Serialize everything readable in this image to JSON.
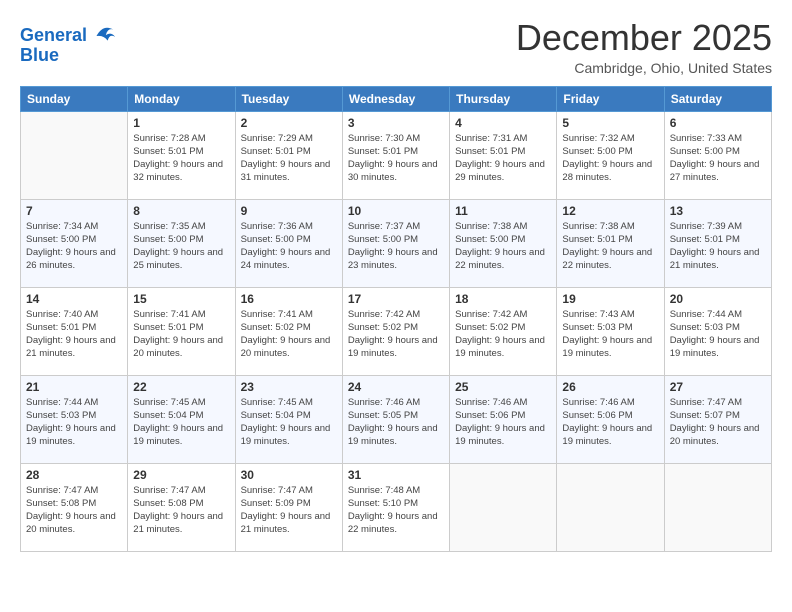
{
  "header": {
    "logo_line1": "General",
    "logo_line2": "Blue",
    "month": "December 2025",
    "location": "Cambridge, Ohio, United States"
  },
  "weekdays": [
    "Sunday",
    "Monday",
    "Tuesday",
    "Wednesday",
    "Thursday",
    "Friday",
    "Saturday"
  ],
  "weeks": [
    [
      {
        "num": "",
        "sunrise": "",
        "sunset": "",
        "daylight": ""
      },
      {
        "num": "1",
        "sunrise": "Sunrise: 7:28 AM",
        "sunset": "Sunset: 5:01 PM",
        "daylight": "Daylight: 9 hours and 32 minutes."
      },
      {
        "num": "2",
        "sunrise": "Sunrise: 7:29 AM",
        "sunset": "Sunset: 5:01 PM",
        "daylight": "Daylight: 9 hours and 31 minutes."
      },
      {
        "num": "3",
        "sunrise": "Sunrise: 7:30 AM",
        "sunset": "Sunset: 5:01 PM",
        "daylight": "Daylight: 9 hours and 30 minutes."
      },
      {
        "num": "4",
        "sunrise": "Sunrise: 7:31 AM",
        "sunset": "Sunset: 5:01 PM",
        "daylight": "Daylight: 9 hours and 29 minutes."
      },
      {
        "num": "5",
        "sunrise": "Sunrise: 7:32 AM",
        "sunset": "Sunset: 5:00 PM",
        "daylight": "Daylight: 9 hours and 28 minutes."
      },
      {
        "num": "6",
        "sunrise": "Sunrise: 7:33 AM",
        "sunset": "Sunset: 5:00 PM",
        "daylight": "Daylight: 9 hours and 27 minutes."
      }
    ],
    [
      {
        "num": "7",
        "sunrise": "Sunrise: 7:34 AM",
        "sunset": "Sunset: 5:00 PM",
        "daylight": "Daylight: 9 hours and 26 minutes."
      },
      {
        "num": "8",
        "sunrise": "Sunrise: 7:35 AM",
        "sunset": "Sunset: 5:00 PM",
        "daylight": "Daylight: 9 hours and 25 minutes."
      },
      {
        "num": "9",
        "sunrise": "Sunrise: 7:36 AM",
        "sunset": "Sunset: 5:00 PM",
        "daylight": "Daylight: 9 hours and 24 minutes."
      },
      {
        "num": "10",
        "sunrise": "Sunrise: 7:37 AM",
        "sunset": "Sunset: 5:00 PM",
        "daylight": "Daylight: 9 hours and 23 minutes."
      },
      {
        "num": "11",
        "sunrise": "Sunrise: 7:38 AM",
        "sunset": "Sunset: 5:00 PM",
        "daylight": "Daylight: 9 hours and 22 minutes."
      },
      {
        "num": "12",
        "sunrise": "Sunrise: 7:38 AM",
        "sunset": "Sunset: 5:01 PM",
        "daylight": "Daylight: 9 hours and 22 minutes."
      },
      {
        "num": "13",
        "sunrise": "Sunrise: 7:39 AM",
        "sunset": "Sunset: 5:01 PM",
        "daylight": "Daylight: 9 hours and 21 minutes."
      }
    ],
    [
      {
        "num": "14",
        "sunrise": "Sunrise: 7:40 AM",
        "sunset": "Sunset: 5:01 PM",
        "daylight": "Daylight: 9 hours and 21 minutes."
      },
      {
        "num": "15",
        "sunrise": "Sunrise: 7:41 AM",
        "sunset": "Sunset: 5:01 PM",
        "daylight": "Daylight: 9 hours and 20 minutes."
      },
      {
        "num": "16",
        "sunrise": "Sunrise: 7:41 AM",
        "sunset": "Sunset: 5:02 PM",
        "daylight": "Daylight: 9 hours and 20 minutes."
      },
      {
        "num": "17",
        "sunrise": "Sunrise: 7:42 AM",
        "sunset": "Sunset: 5:02 PM",
        "daylight": "Daylight: 9 hours and 19 minutes."
      },
      {
        "num": "18",
        "sunrise": "Sunrise: 7:42 AM",
        "sunset": "Sunset: 5:02 PM",
        "daylight": "Daylight: 9 hours and 19 minutes."
      },
      {
        "num": "19",
        "sunrise": "Sunrise: 7:43 AM",
        "sunset": "Sunset: 5:03 PM",
        "daylight": "Daylight: 9 hours and 19 minutes."
      },
      {
        "num": "20",
        "sunrise": "Sunrise: 7:44 AM",
        "sunset": "Sunset: 5:03 PM",
        "daylight": "Daylight: 9 hours and 19 minutes."
      }
    ],
    [
      {
        "num": "21",
        "sunrise": "Sunrise: 7:44 AM",
        "sunset": "Sunset: 5:03 PM",
        "daylight": "Daylight: 9 hours and 19 minutes."
      },
      {
        "num": "22",
        "sunrise": "Sunrise: 7:45 AM",
        "sunset": "Sunset: 5:04 PM",
        "daylight": "Daylight: 9 hours and 19 minutes."
      },
      {
        "num": "23",
        "sunrise": "Sunrise: 7:45 AM",
        "sunset": "Sunset: 5:04 PM",
        "daylight": "Daylight: 9 hours and 19 minutes."
      },
      {
        "num": "24",
        "sunrise": "Sunrise: 7:46 AM",
        "sunset": "Sunset: 5:05 PM",
        "daylight": "Daylight: 9 hours and 19 minutes."
      },
      {
        "num": "25",
        "sunrise": "Sunrise: 7:46 AM",
        "sunset": "Sunset: 5:06 PM",
        "daylight": "Daylight: 9 hours and 19 minutes."
      },
      {
        "num": "26",
        "sunrise": "Sunrise: 7:46 AM",
        "sunset": "Sunset: 5:06 PM",
        "daylight": "Daylight: 9 hours and 19 minutes."
      },
      {
        "num": "27",
        "sunrise": "Sunrise: 7:47 AM",
        "sunset": "Sunset: 5:07 PM",
        "daylight": "Daylight: 9 hours and 20 minutes."
      }
    ],
    [
      {
        "num": "28",
        "sunrise": "Sunrise: 7:47 AM",
        "sunset": "Sunset: 5:08 PM",
        "daylight": "Daylight: 9 hours and 20 minutes."
      },
      {
        "num": "29",
        "sunrise": "Sunrise: 7:47 AM",
        "sunset": "Sunset: 5:08 PM",
        "daylight": "Daylight: 9 hours and 21 minutes."
      },
      {
        "num": "30",
        "sunrise": "Sunrise: 7:47 AM",
        "sunset": "Sunset: 5:09 PM",
        "daylight": "Daylight: 9 hours and 21 minutes."
      },
      {
        "num": "31",
        "sunrise": "Sunrise: 7:48 AM",
        "sunset": "Sunset: 5:10 PM",
        "daylight": "Daylight: 9 hours and 22 minutes."
      },
      {
        "num": "",
        "sunrise": "",
        "sunset": "",
        "daylight": ""
      },
      {
        "num": "",
        "sunrise": "",
        "sunset": "",
        "daylight": ""
      },
      {
        "num": "",
        "sunrise": "",
        "sunset": "",
        "daylight": ""
      }
    ]
  ]
}
